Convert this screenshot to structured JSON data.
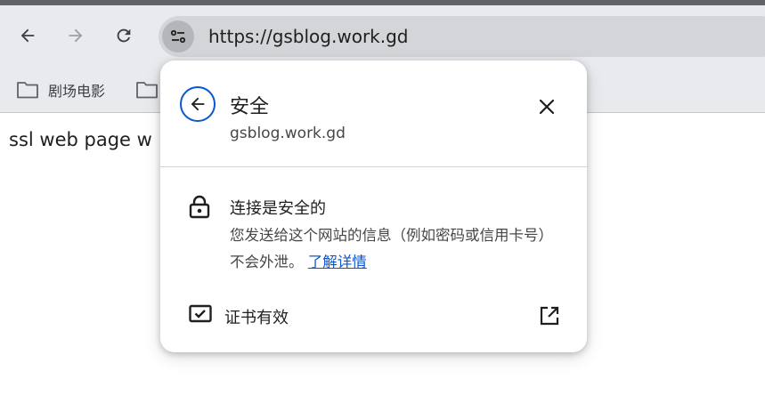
{
  "omnibox": {
    "url": "https://gsblog.work.gd"
  },
  "bookmarks": {
    "items": [
      {
        "label": "剧场电影"
      }
    ]
  },
  "page": {
    "text": "ssl web page w"
  },
  "popup": {
    "title": "安全",
    "host": "gsblog.work.gd",
    "connection": {
      "title": "连接是安全的",
      "description": "您发送给这个网站的信息（例如密码或信用卡号）不会外泄。",
      "learn_more": "了解详情"
    },
    "certificate": {
      "label": "证书有效"
    }
  },
  "icons": {
    "back": "arrow-left-icon",
    "forward": "arrow-right-icon",
    "reload": "reload-icon",
    "site_info": "tune-icon",
    "folder": "folder-icon",
    "popup_back": "circle-arrow-left-icon",
    "close": "close-icon",
    "lock": "lock-icon",
    "certificate": "certificate-icon",
    "external": "open-in-new-icon"
  },
  "colors": {
    "accent": "#0b57d0",
    "toolbar": "#e8eaed",
    "omnibox": "#d3d5d8"
  }
}
